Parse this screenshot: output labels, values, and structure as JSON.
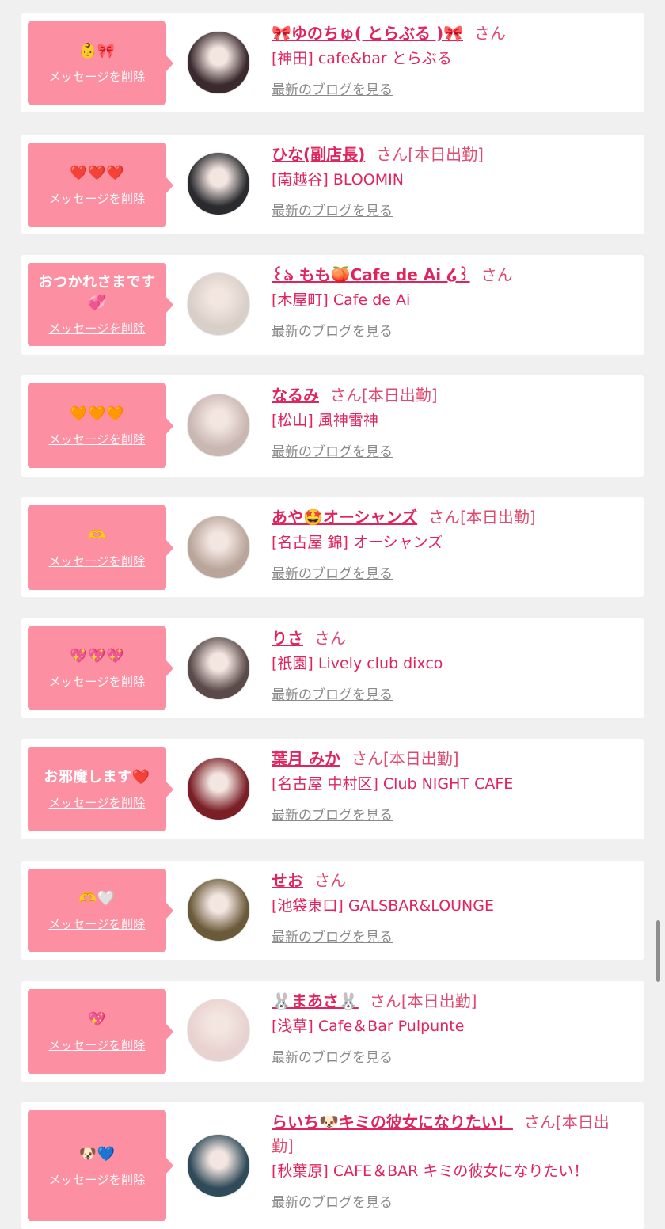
{
  "entries": [
    {
      "bubble_text": "👶🎀",
      "delete_label": "メッセージを削除",
      "name": "🎀ゆのちゅ( とらぶる )🎀",
      "san": "さん",
      "shift": "",
      "shop": "[神田] cafe&bar とらぶる",
      "blog_label": "最新のブログを見る",
      "avatar_color": "#3a2a2e"
    },
    {
      "bubble_text": "❤️❤️❤️",
      "delete_label": "メッセージを削除",
      "name": "ひな(副店長)",
      "san": "さん",
      "shift": "[本日出勤]",
      "shop": "[南越谷] BLOOMIN",
      "blog_label": "最新のブログを見る",
      "avatar_color": "#2b2b2f"
    },
    {
      "bubble_text": "おつかれさまです💞",
      "delete_label": "メッセージを削除",
      "name": "꒰ঌ もも🍑Cafe de Ai ໒꒱",
      "san": "さん",
      "shift": "",
      "shop": "[木屋町] Cafe de Ai",
      "blog_label": "最新のブログを見る",
      "avatar_color": "#d9cfc9"
    },
    {
      "bubble_text": "🧡🧡🧡",
      "delete_label": "メッセージを削除",
      "name": "なるみ",
      "san": "さん",
      "shift": "[本日出勤]",
      "shop": "[松山] 風神雷神",
      "blog_label": "最新のブログを見る",
      "avatar_color": "#c9b7b2"
    },
    {
      "bubble_text": "🫶",
      "delete_label": "メッセージを削除",
      "name": "あや🤩オーシャンズ",
      "san": "さん",
      "shift": "[本日出勤]",
      "shop": "[名古屋 錦] オーシャンズ",
      "blog_label": "最新のブログを見る",
      "avatar_color": "#b9a59a"
    },
    {
      "bubble_text": "💖💖💖",
      "delete_label": "メッセージを削除",
      "name": "りさ",
      "san": "さん",
      "shift": "",
      "shop": "[祇園] Lively club dixco",
      "blog_label": "最新のブログを見る",
      "avatar_color": "#5a4a4a"
    },
    {
      "bubble_text": "お邪魔します❤️",
      "delete_label": "メッセージを削除",
      "name": "葉月 みか",
      "san": "さん",
      "shift": "[本日出勤]",
      "shop": "[名古屋 中村区] Club NIGHT CAFE",
      "blog_label": "最新のブログを見る",
      "avatar_color": "#7a1f26"
    },
    {
      "bubble_text": "🫶🤍",
      "delete_label": "メッセージを削除",
      "name": "せお",
      "san": "さん",
      "shift": "",
      "shop": "[池袋東口] GALSBAR&LOUNGE",
      "blog_label": "最新のブログを見る",
      "avatar_color": "#6b5a3a"
    },
    {
      "bubble_text": "💖",
      "delete_label": "メッセージを削除",
      "name": "🐰まあさ🐰",
      "san": "さん",
      "shift": "[本日出勤]",
      "shop": "[浅草] Cafe＆Bar Pulpunte",
      "blog_label": "最新のブログを見る",
      "avatar_color": "#e8d2cf"
    },
    {
      "bubble_text": "🐶💙",
      "delete_label": "メッセージを削除",
      "name": "らいち🐶キミの彼女になりたい！",
      "san": "さん",
      "shift": "[本日出勤]",
      "shop": "[秋葉原] CAFE＆BAR キミの彼女になりたい！",
      "blog_label": "最新のブログを見る",
      "avatar_color": "#2f4a58"
    }
  ]
}
